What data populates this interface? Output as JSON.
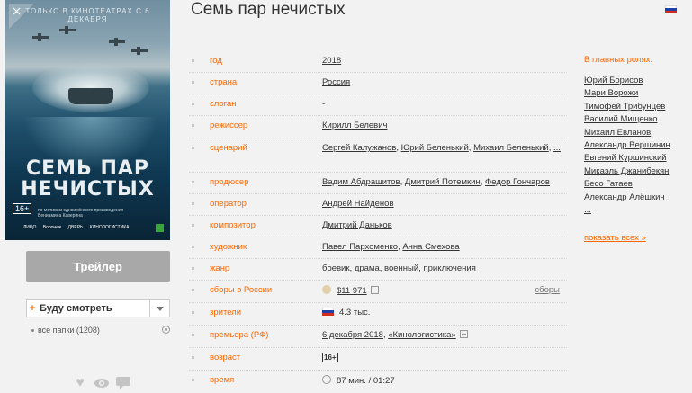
{
  "colors": {
    "accent": "#ff6600",
    "trailer_bg": "#a8a8a8",
    "background": "#f2f2f2"
  },
  "movie": {
    "title": "Семь пар нечистых"
  },
  "poster": {
    "tagline": "ТОЛЬКО В КИНОТЕАТРАХ С 6 ДЕКАБРЯ",
    "title_line1": "СЕМЬ ПАР",
    "title_line2": "НЕЧИСТЫХ",
    "age": "16+",
    "credits": "по мотивам одноимённого произведения Вениамина Каверина",
    "logos": [
      "ЛИЦО",
      "Воронеж",
      "ДВЕРЬ",
      "КИНОЛОГИСТИКА"
    ]
  },
  "sidebar": {
    "trailer_label": "Трейлер",
    "watchlist_plus": "+",
    "watchlist_label": "Буду смотреть",
    "folders_label": "все папки (1208)",
    "icons": [
      "heart-icon",
      "eye-icon",
      "comment-icon"
    ]
  },
  "info": {
    "year": {
      "key": "год",
      "value": "2018"
    },
    "country": {
      "key": "страна",
      "value": "Россия"
    },
    "slogan": {
      "key": "слоган",
      "value": "-"
    },
    "director": {
      "key": "режиссер",
      "value": "Кирилл Белевич"
    },
    "writer": {
      "key": "сценарий",
      "values": [
        "Сергей Калужанов",
        "Юрий Беленький",
        "Михаил Беленький",
        "..."
      ]
    },
    "producer": {
      "key": "продюсер",
      "values": [
        "Вадим Абдрашитов",
        "Дмитрий Потемкин",
        "Федор Гончаров"
      ]
    },
    "operator": {
      "key": "оператор",
      "value": "Андрей Найденов"
    },
    "composer": {
      "key": "композитор",
      "value": "Дмитрий Даньков"
    },
    "artist": {
      "key": "художник",
      "values": [
        "Павел Пархоменко",
        "Анна Смехова"
      ]
    },
    "genre": {
      "key": "жанр",
      "values": [
        "боевик",
        "драма",
        "военный",
        "приключения"
      ]
    },
    "boxoffice": {
      "key": "сборы в России",
      "value": "$11 971",
      "link": "сборы"
    },
    "viewers": {
      "key": "зрители",
      "value": "4.3 тыс."
    },
    "premiere": {
      "key": "премьера (РФ)",
      "date": "6 декабря 2018",
      "distributor": "«Кинологистика»"
    },
    "age": {
      "key": "возраст",
      "value": "16+"
    },
    "time": {
      "key": "время",
      "value": "87 мин. / 01:27"
    }
  },
  "cast": {
    "heading": "В главных ролях:",
    "actors": [
      "Юрий Борисов",
      "Мари Ворожи",
      "Тимофей Трибунцев",
      "Василий Мищенко",
      "Михаил Евланов",
      "Александр Вершинин",
      "Евгений Куршинский",
      "Микаэль Джанибекян",
      "Бесо Гатаев",
      "Александр Алёшкин",
      "..."
    ],
    "more": "показать всех »"
  }
}
